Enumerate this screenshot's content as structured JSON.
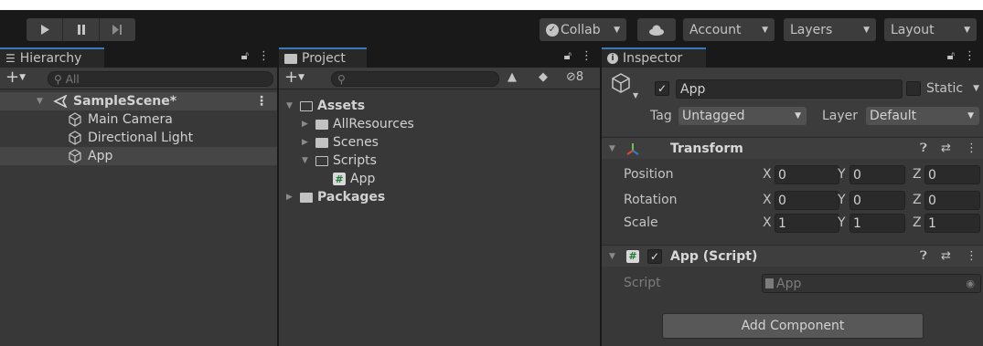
{
  "toolbar": {
    "collab": "Collab",
    "account": "Account",
    "layers": "Layers",
    "layout": "Layout"
  },
  "hierarchy": {
    "tab": "Hierarchy",
    "search_placeholder": "All",
    "scene": "SampleScene*",
    "items": [
      "Main Camera",
      "Directional Light",
      "App"
    ]
  },
  "project": {
    "tab": "Project",
    "hidden_count": "8",
    "tree": {
      "assets": "Assets",
      "all_resources": "AllResources",
      "scenes": "Scenes",
      "scripts": "Scripts",
      "app_script": "App",
      "packages": "Packages"
    }
  },
  "inspector": {
    "tab": "Inspector",
    "object_name": "App",
    "static_label": "Static",
    "tag_label": "Tag",
    "tag_value": "Untagged",
    "layer_label": "Layer",
    "layer_value": "Default",
    "transform": {
      "title": "Transform",
      "position_label": "Position",
      "rotation_label": "Rotation",
      "scale_label": "Scale",
      "position": {
        "x": "0",
        "y": "0",
        "z": "0"
      },
      "rotation": {
        "x": "0",
        "y": "0",
        "z": "0"
      },
      "scale": {
        "x": "1",
        "y": "1",
        "z": "1"
      }
    },
    "script_component": {
      "title": "App (Script)",
      "script_label": "Script",
      "script_value": "App"
    },
    "add_component": "Add Component",
    "axis": {
      "x": "X",
      "y": "Y",
      "z": "Z"
    }
  },
  "colors": {
    "accent": "#3a79bb",
    "panel": "#383838",
    "background": "#191919"
  }
}
